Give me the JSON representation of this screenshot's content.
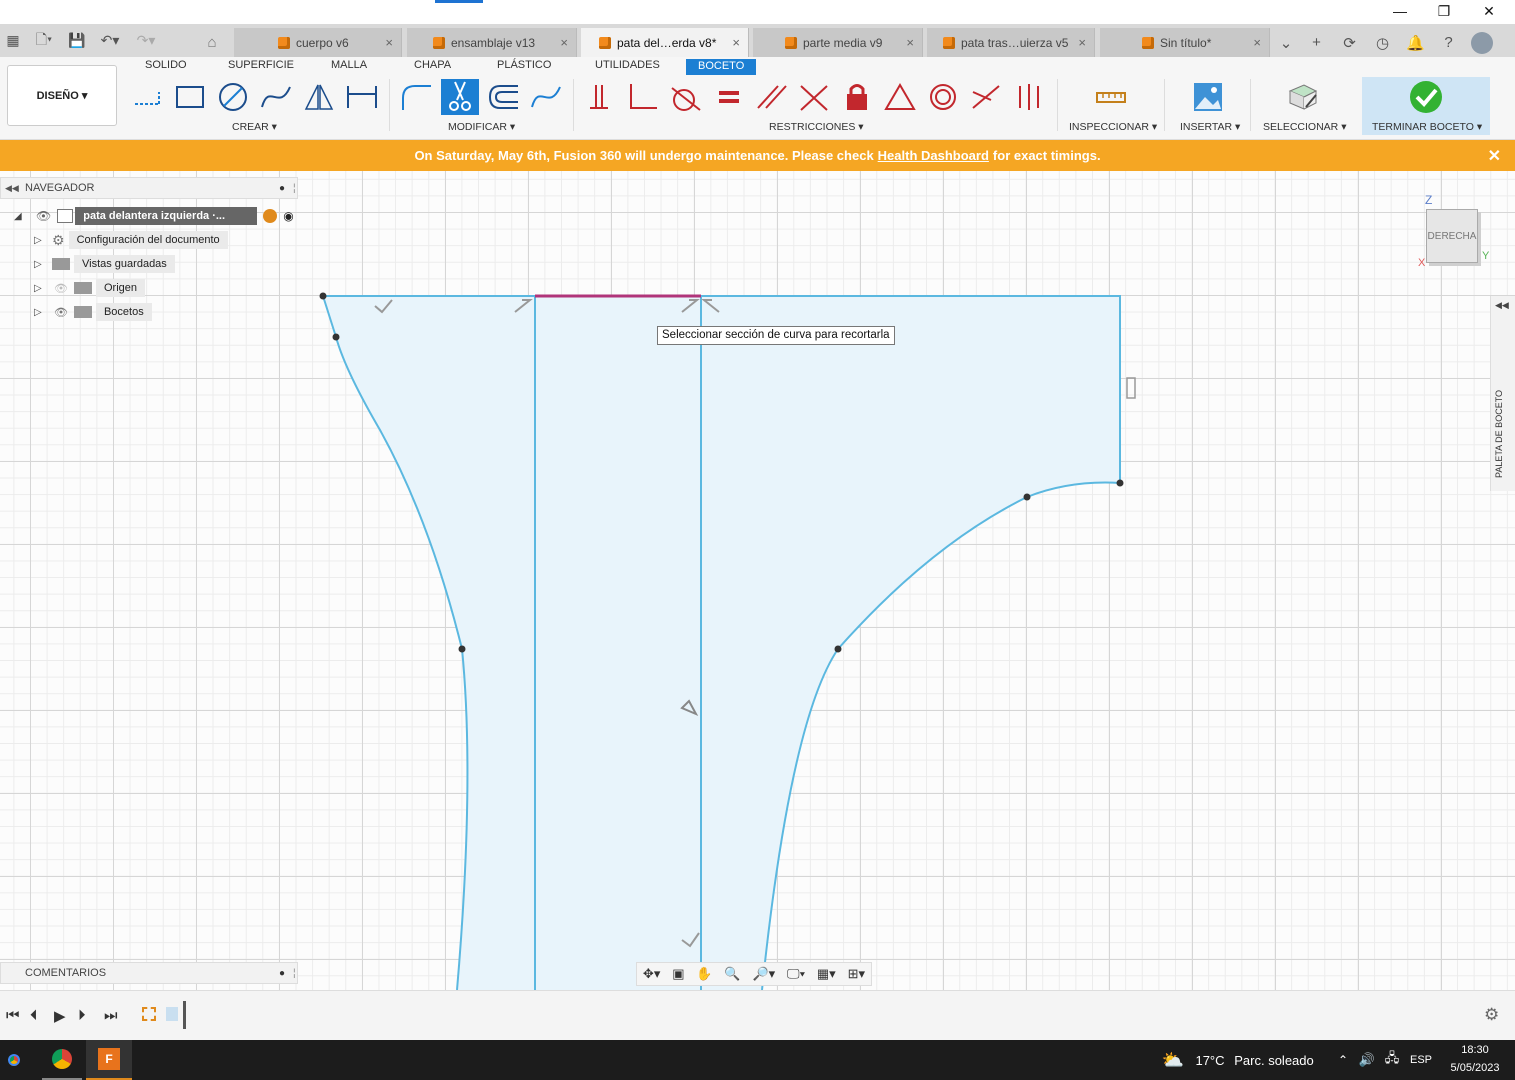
{
  "tabs": {
    "items": [
      {
        "label": "cuerpo v6"
      },
      {
        "label": "ensamblaje v13"
      },
      {
        "label": "pata del…erda v8*"
      },
      {
        "label": "parte media v9"
      },
      {
        "label": "pata tras…uierza v5"
      },
      {
        "label": "Sin título*"
      }
    ],
    "active_index": 2,
    "close_glyph": "×"
  },
  "ribbon": {
    "workspace": "DISEÑO",
    "tabs": [
      "SOLIDO",
      "SUPERFICIE",
      "MALLA",
      "CHAPA",
      "PLÁSTICO",
      "UTILIDADES",
      "BOCETO"
    ],
    "active_tab": "BOCETO",
    "groups": {
      "crear": "CREAR",
      "modificar": "MODIFICAR",
      "restricciones": "RESTRICCIONES",
      "inspeccionar": "INSPECCIONAR",
      "insertar": "INSERTAR",
      "seleccionar": "SELECCIONAR",
      "terminar": "TERMINAR BOCETO"
    },
    "accent": "#1c7fd3"
  },
  "banner": {
    "prefix": "On Saturday, May 6th, Fusion 360 will undergo maintenance. Please check",
    "link": "Health Dashboard",
    "suffix": "for exact timings.",
    "color": "#f5a623"
  },
  "navigator": {
    "title": "NAVEGADOR",
    "root": "pata delantera izquierda ·...",
    "items": [
      {
        "label": "Configuración del documento"
      },
      {
        "label": "Vistas guardadas"
      },
      {
        "label": "Origen"
      },
      {
        "label": "Bocetos"
      }
    ]
  },
  "tooltip": "Seleccionar sección de curva para recortarla",
  "viewcube": {
    "face": "DERECHA",
    "axis_z": "Z",
    "axis_y": "Y",
    "axis_x": "X"
  },
  "palette": {
    "label": "PALETA DE BOCETO"
  },
  "comments": {
    "title": "COMENTARIOS"
  },
  "taskbar": {
    "weather_temp": "17°C",
    "weather_text": "Parc. soleado",
    "language": "ESP",
    "time": "18:30",
    "date": "5/05/2023"
  },
  "colors": {
    "sketch_line": "#5bb8e0",
    "sketch_fill": "#e8f4fb",
    "highlight": "#b0347a"
  }
}
